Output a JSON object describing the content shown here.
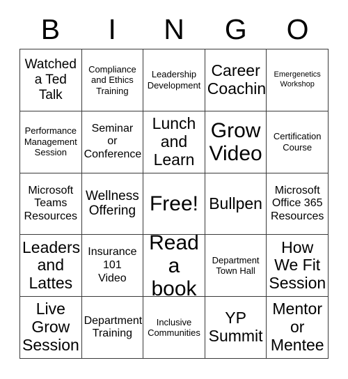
{
  "card": {
    "title": "BINGO",
    "header_letters": [
      "B",
      "I",
      "N",
      "G",
      "O"
    ],
    "colors": {
      "background": "#ffffff",
      "border": "#3a3a3a",
      "text": "#000000"
    },
    "grid": {
      "columns": 5,
      "rows": 5,
      "free_space_label": "Free!",
      "free_space_position": "center"
    },
    "cells": [
      {
        "text": "Watched\na Ted\nTalk",
        "size": "lg",
        "row": 1,
        "col": 1
      },
      {
        "text": "Compliance\nand Ethics\nTraining",
        "size": "sm",
        "row": 1,
        "col": 2
      },
      {
        "text": "Leadership\nDevelopment",
        "size": "sm",
        "row": 1,
        "col": 3
      },
      {
        "text": "Career\nCoaching",
        "size": "xl",
        "row": 1,
        "col": 4
      },
      {
        "text": "Emergenetics\nWorkshop",
        "size": "xs",
        "row": 1,
        "col": 5
      },
      {
        "text": "Performance\nManagement\nSession",
        "size": "sm",
        "row": 2,
        "col": 1
      },
      {
        "text": "Seminar\nor\nConference",
        "size": "md",
        "row": 2,
        "col": 2
      },
      {
        "text": "Lunch\nand\nLearn",
        "size": "xl",
        "row": 2,
        "col": 3
      },
      {
        "text": "Grow\nVideo",
        "size": "xxl",
        "row": 2,
        "col": 4
      },
      {
        "text": "Certification\nCourse",
        "size": "sm",
        "row": 2,
        "col": 5
      },
      {
        "text": "Microsoft\nTeams\nResources",
        "size": "md",
        "row": 3,
        "col": 1
      },
      {
        "text": "Wellness\nOffering",
        "size": "lg",
        "row": 3,
        "col": 2
      },
      {
        "text": "Free!",
        "size": "xxl",
        "row": 3,
        "col": 3
      },
      {
        "text": "Bullpen",
        "size": "xl",
        "row": 3,
        "col": 4
      },
      {
        "text": "Microsoft\nOffice 365\nResources",
        "size": "md",
        "row": 3,
        "col": 5
      },
      {
        "text": "Leaders\nand\nLattes",
        "size": "xl",
        "row": 4,
        "col": 1
      },
      {
        "text": "Insurance\n101\nVideo",
        "size": "md",
        "row": 4,
        "col": 2
      },
      {
        "text": "Read\na book",
        "size": "xxl",
        "row": 4,
        "col": 3
      },
      {
        "text": "Department\nTown Hall",
        "size": "sm",
        "row": 4,
        "col": 4
      },
      {
        "text": "How\nWe Fit\nSession",
        "size": "xl",
        "row": 4,
        "col": 5
      },
      {
        "text": "Live\nGrow\nSession",
        "size": "xl",
        "row": 5,
        "col": 1
      },
      {
        "text": "Department\nTraining",
        "size": "md",
        "row": 5,
        "col": 2
      },
      {
        "text": "Inclusive\nCommunities",
        "size": "sm",
        "row": 5,
        "col": 3
      },
      {
        "text": "YP\nSummit",
        "size": "xl",
        "row": 5,
        "col": 4
      },
      {
        "text": "Mentor\nor\nMentee",
        "size": "xl",
        "row": 5,
        "col": 5
      }
    ]
  }
}
